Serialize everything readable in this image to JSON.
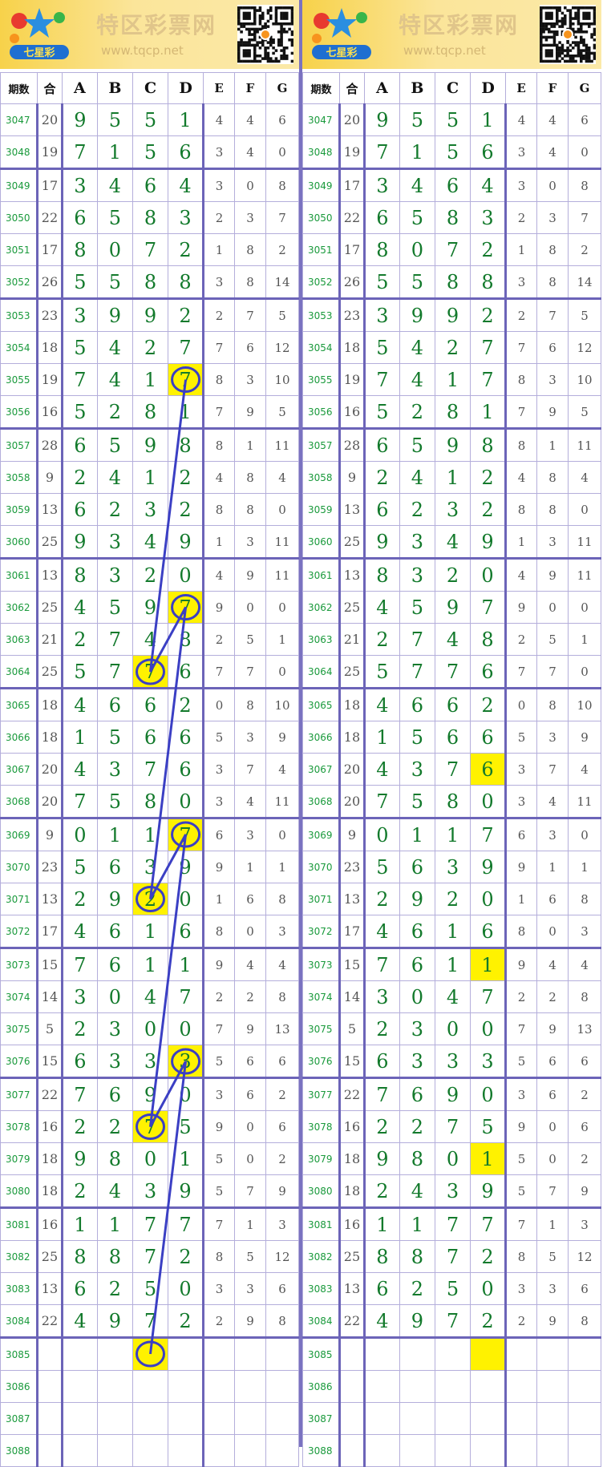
{
  "site": {
    "title": "特区彩票网",
    "url": "www.tqcp.net",
    "logo_text": "七星彩"
  },
  "headers": [
    "期数",
    "合",
    "A",
    "B",
    "C",
    "D",
    "E",
    "F",
    "G"
  ],
  "rows": [
    {
      "qs": "3047",
      "he": "20",
      "a": "9",
      "b": "5",
      "c": "5",
      "d": "1",
      "e": "4",
      "f": "4",
      "g": "6"
    },
    {
      "qs": "3048",
      "he": "19",
      "a": "7",
      "b": "1",
      "c": "5",
      "d": "6",
      "e": "3",
      "f": "4",
      "g": "0"
    },
    {
      "qs": "3049",
      "he": "17",
      "a": "3",
      "b": "4",
      "c": "6",
      "d": "4",
      "e": "3",
      "f": "0",
      "g": "8"
    },
    {
      "qs": "3050",
      "he": "22",
      "a": "6",
      "b": "5",
      "c": "8",
      "d": "3",
      "e": "2",
      "f": "3",
      "g": "7"
    },
    {
      "qs": "3051",
      "he": "17",
      "a": "8",
      "b": "0",
      "c": "7",
      "d": "2",
      "e": "1",
      "f": "8",
      "g": "2"
    },
    {
      "qs": "3052",
      "he": "26",
      "a": "5",
      "b": "5",
      "c": "8",
      "d": "8",
      "e": "3",
      "f": "8",
      "g": "14"
    },
    {
      "qs": "3053",
      "he": "23",
      "a": "3",
      "b": "9",
      "c": "9",
      "d": "2",
      "e": "2",
      "f": "7",
      "g": "5"
    },
    {
      "qs": "3054",
      "he": "18",
      "a": "5",
      "b": "4",
      "c": "2",
      "d": "7",
      "e": "7",
      "f": "6",
      "g": "12"
    },
    {
      "qs": "3055",
      "he": "19",
      "a": "7",
      "b": "4",
      "c": "1",
      "d": "7",
      "e": "8",
      "f": "3",
      "g": "10"
    },
    {
      "qs": "3056",
      "he": "16",
      "a": "5",
      "b": "2",
      "c": "8",
      "d": "1",
      "e": "7",
      "f": "9",
      "g": "5"
    },
    {
      "qs": "3057",
      "he": "28",
      "a": "6",
      "b": "5",
      "c": "9",
      "d": "8",
      "e": "8",
      "f": "1",
      "g": "11"
    },
    {
      "qs": "3058",
      "he": "9",
      "a": "2",
      "b": "4",
      "c": "1",
      "d": "2",
      "e": "4",
      "f": "8",
      "g": "4"
    },
    {
      "qs": "3059",
      "he": "13",
      "a": "6",
      "b": "2",
      "c": "3",
      "d": "2",
      "e": "8",
      "f": "8",
      "g": "0"
    },
    {
      "qs": "3060",
      "he": "25",
      "a": "9",
      "b": "3",
      "c": "4",
      "d": "9",
      "e": "1",
      "f": "3",
      "g": "11"
    },
    {
      "qs": "3061",
      "he": "13",
      "a": "8",
      "b": "3",
      "c": "2",
      "d": "0",
      "e": "4",
      "f": "9",
      "g": "11"
    },
    {
      "qs": "3062",
      "he": "25",
      "a": "4",
      "b": "5",
      "c": "9",
      "d": "7",
      "e": "9",
      "f": "0",
      "g": "0"
    },
    {
      "qs": "3063",
      "he": "21",
      "a": "2",
      "b": "7",
      "c": "4",
      "d": "8",
      "e": "2",
      "f": "5",
      "g": "1"
    },
    {
      "qs": "3064",
      "he": "25",
      "a": "5",
      "b": "7",
      "c": "7",
      "d": "6",
      "e": "7",
      "f": "7",
      "g": "0"
    },
    {
      "qs": "3065",
      "he": "18",
      "a": "4",
      "b": "6",
      "c": "6",
      "d": "2",
      "e": "0",
      "f": "8",
      "g": "10"
    },
    {
      "qs": "3066",
      "he": "18",
      "a": "1",
      "b": "5",
      "c": "6",
      "d": "6",
      "e": "5",
      "f": "3",
      "g": "9"
    },
    {
      "qs": "3067",
      "he": "20",
      "a": "4",
      "b": "3",
      "c": "7",
      "d": "6",
      "e": "3",
      "f": "7",
      "g": "4"
    },
    {
      "qs": "3068",
      "he": "20",
      "a": "7",
      "b": "5",
      "c": "8",
      "d": "0",
      "e": "3",
      "f": "4",
      "g": "11"
    },
    {
      "qs": "3069",
      "he": "9",
      "a": "0",
      "b": "1",
      "c": "1",
      "d": "7",
      "e": "6",
      "f": "3",
      "g": "0"
    },
    {
      "qs": "3070",
      "he": "23",
      "a": "5",
      "b": "6",
      "c": "3",
      "d": "9",
      "e": "9",
      "f": "1",
      "g": "1"
    },
    {
      "qs": "3071",
      "he": "13",
      "a": "2",
      "b": "9",
      "c": "2",
      "d": "0",
      "e": "1",
      "f": "6",
      "g": "8"
    },
    {
      "qs": "3072",
      "he": "17",
      "a": "4",
      "b": "6",
      "c": "1",
      "d": "6",
      "e": "8",
      "f": "0",
      "g": "3"
    },
    {
      "qs": "3073",
      "he": "15",
      "a": "7",
      "b": "6",
      "c": "1",
      "d": "1",
      "e": "9",
      "f": "4",
      "g": "4"
    },
    {
      "qs": "3074",
      "he": "14",
      "a": "3",
      "b": "0",
      "c": "4",
      "d": "7",
      "e": "2",
      "f": "2",
      "g": "8"
    },
    {
      "qs": "3075",
      "he": "5",
      "a": "2",
      "b": "3",
      "c": "0",
      "d": "0",
      "e": "7",
      "f": "9",
      "g": "13"
    },
    {
      "qs": "3076",
      "he": "15",
      "a": "6",
      "b": "3",
      "c": "3",
      "d": "3",
      "e": "5",
      "f": "6",
      "g": "6"
    },
    {
      "qs": "3077",
      "he": "22",
      "a": "7",
      "b": "6",
      "c": "9",
      "d": "0",
      "e": "3",
      "f": "6",
      "g": "2"
    },
    {
      "qs": "3078",
      "he": "16",
      "a": "2",
      "b": "2",
      "c": "7",
      "d": "5",
      "e": "9",
      "f": "0",
      "g": "6"
    },
    {
      "qs": "3079",
      "he": "18",
      "a": "9",
      "b": "8",
      "c": "0",
      "d": "1",
      "e": "5",
      "f": "0",
      "g": "2"
    },
    {
      "qs": "3080",
      "he": "18",
      "a": "2",
      "b": "4",
      "c": "3",
      "d": "9",
      "e": "5",
      "f": "7",
      "g": "9"
    },
    {
      "qs": "3081",
      "he": "16",
      "a": "1",
      "b": "1",
      "c": "7",
      "d": "7",
      "e": "7",
      "f": "1",
      "g": "3"
    },
    {
      "qs": "3082",
      "he": "25",
      "a": "8",
      "b": "8",
      "c": "7",
      "d": "2",
      "e": "8",
      "f": "5",
      "g": "12"
    },
    {
      "qs": "3083",
      "he": "13",
      "a": "6",
      "b": "2",
      "c": "5",
      "d": "0",
      "e": "3",
      "f": "3",
      "g": "6"
    },
    {
      "qs": "3084",
      "he": "22",
      "a": "4",
      "b": "9",
      "c": "7",
      "d": "2",
      "e": "2",
      "f": "9",
      "g": "8"
    },
    {
      "qs": "3085",
      "he": "",
      "a": "",
      "b": "",
      "c": "",
      "d": "",
      "e": "",
      "f": "",
      "g": ""
    },
    {
      "qs": "3086",
      "he": "",
      "a": "",
      "b": "",
      "c": "",
      "d": "",
      "e": "",
      "f": "",
      "g": ""
    },
    {
      "qs": "3087",
      "he": "",
      "a": "",
      "b": "",
      "c": "",
      "d": "",
      "e": "",
      "f": "",
      "g": ""
    },
    {
      "qs": "3088",
      "he": "",
      "a": "",
      "b": "",
      "c": "",
      "d": "",
      "e": "",
      "f": "",
      "g": ""
    }
  ],
  "left_highlights": [
    {
      "row": 8,
      "col": "d"
    },
    {
      "row": 15,
      "col": "d"
    },
    {
      "row": 17,
      "col": "c"
    },
    {
      "row": 22,
      "col": "d"
    },
    {
      "row": 24,
      "col": "c"
    },
    {
      "row": 29,
      "col": "d"
    },
    {
      "row": 31,
      "col": "c"
    },
    {
      "row": 38,
      "col": "c"
    }
  ],
  "left_path": [
    {
      "row": 8,
      "col": "d"
    },
    {
      "row": 17,
      "col": "c"
    },
    {
      "row": 15,
      "col": "d"
    },
    {
      "row": 24,
      "col": "c"
    },
    {
      "row": 22,
      "col": "d"
    },
    {
      "row": 31,
      "col": "c"
    },
    {
      "row": 29,
      "col": "d"
    },
    {
      "row": 38,
      "col": "c"
    }
  ],
  "right_highlights": [
    {
      "row": 20,
      "col": "d"
    },
    {
      "row": 26,
      "col": "d"
    },
    {
      "row": 32,
      "col": "d"
    },
    {
      "row": 38,
      "col": "d"
    }
  ],
  "colors": {
    "highlight": "#fff200",
    "circle": "#3b3fc4",
    "line": "#3b3fc4",
    "main_digit": "#137a2c",
    "period": "#1a9a3c",
    "group_border": "#6c64b8",
    "panel_divider": "#7a72c0"
  }
}
